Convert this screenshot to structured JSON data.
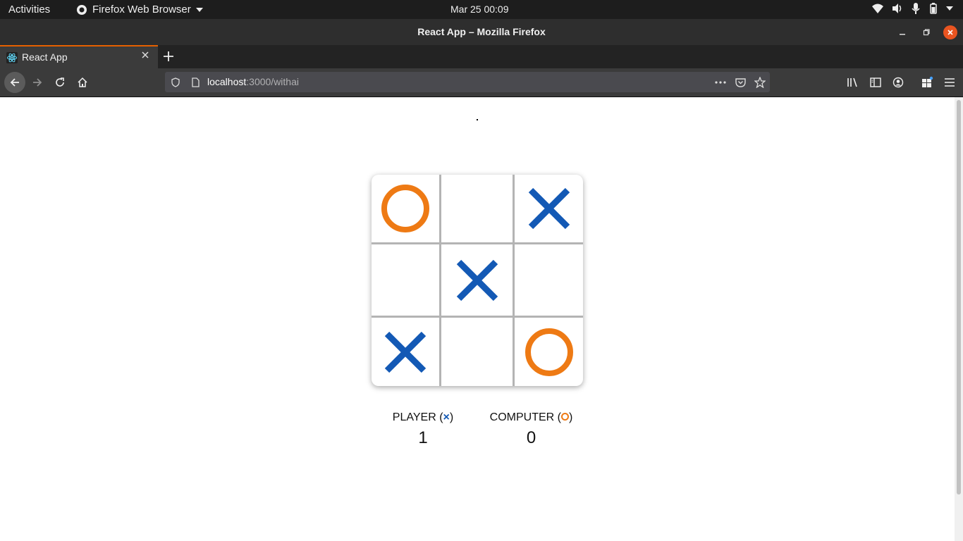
{
  "os_topbar": {
    "activities": "Activities",
    "app_name": "Firefox Web Browser",
    "clock": "Mar 25  00:09"
  },
  "window": {
    "title": "React App – Mozilla Firefox"
  },
  "tabs": [
    {
      "label": "React App",
      "active": true
    }
  ],
  "navbar": {
    "url_host": "localhost",
    "url_path": ":3000/withai"
  },
  "game": {
    "board": [
      "O",
      "",
      "X",
      "",
      "X",
      "",
      "X",
      "",
      "O"
    ],
    "player_label": "PLAYER",
    "computer_label": "COMPUTER",
    "player_score": "1",
    "computer_score": "0",
    "player_symbol": "X",
    "computer_symbol": "O"
  },
  "colors": {
    "x_mark": "#1359b5",
    "o_mark": "#ee7a14",
    "grid_line": "#b4b4b4"
  }
}
